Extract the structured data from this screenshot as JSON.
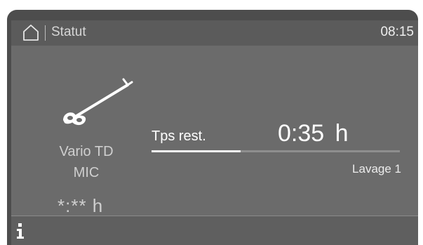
{
  "header": {
    "home_icon": "home-icon",
    "title": "Statut",
    "time": "08:15"
  },
  "program": {
    "icon": "tool-icon",
    "name_line1": "Vario TD",
    "name_line2": "MIC",
    "duration": "*:** h"
  },
  "status": {
    "remaining_label": "Tps rest.",
    "remaining_value": "0:35  h",
    "progress_fraction": 0.36,
    "phase": "Lavage 1"
  },
  "footer": {
    "info_icon": "info-icon"
  },
  "colors": {
    "screen_bg": "#6b6b6b",
    "bar_bg": "#5b5b5b",
    "frame": "#4d4d4d",
    "progress_fill": "#f2f2f2",
    "progress_track": "#8e8e8e"
  }
}
